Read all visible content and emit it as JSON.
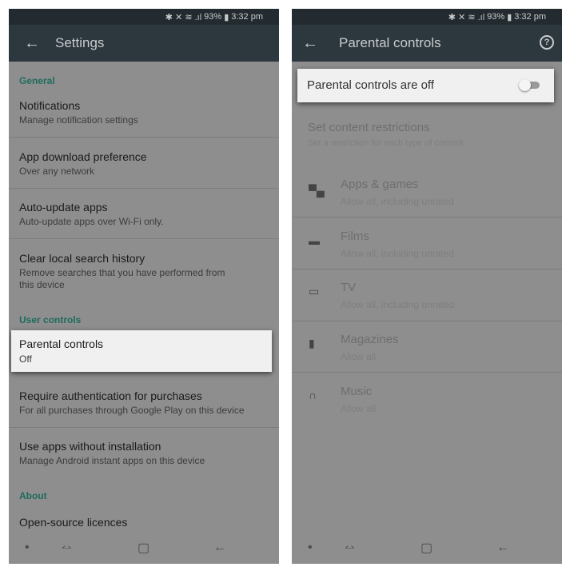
{
  "status": {
    "icons": "bluetooth mute wifi signal",
    "battery": "93%",
    "time": "3:32 pm"
  },
  "settings": {
    "title": "Settings",
    "general": "General",
    "items": [
      {
        "title": "Notifications",
        "sub": "Manage notification settings"
      },
      {
        "title": "App download preference",
        "sub": "Over any network"
      },
      {
        "title": "Auto-update apps",
        "sub": "Auto-update apps over Wi-Fi only."
      },
      {
        "title": "Clear local search history",
        "sub": "Remove searches that you have performed from this device"
      }
    ],
    "user_controls": "User controls",
    "parental": {
      "title": "Parental controls",
      "sub": "Off"
    },
    "items2": [
      {
        "title": "Require authentication for purchases",
        "sub": "For all purchases through Google Play on this device"
      },
      {
        "title": "Use apps without installation",
        "sub": "Manage Android instant apps on this device"
      }
    ],
    "about": "About",
    "open_source": "Open-source licences"
  },
  "parental": {
    "title": "Parental controls",
    "toggle_label": "Parental controls are off",
    "toggle_on": false,
    "restrictions_title": "Set content restrictions",
    "restrictions_sub": "Set a restriction for each type of content",
    "categories": [
      {
        "icon": "android-icon",
        "title": "Apps & games",
        "sub": "Allow all, including unrated"
      },
      {
        "icon": "film-icon",
        "title": "Films",
        "sub": "Allow all, including unrated"
      },
      {
        "icon": "tv-icon",
        "title": "TV",
        "sub": "Allow all, including unrated"
      },
      {
        "icon": "magazine-icon",
        "title": "Magazines",
        "sub": "Allow all"
      },
      {
        "icon": "headphones-icon",
        "title": "Music",
        "sub": "Allow all"
      }
    ]
  }
}
